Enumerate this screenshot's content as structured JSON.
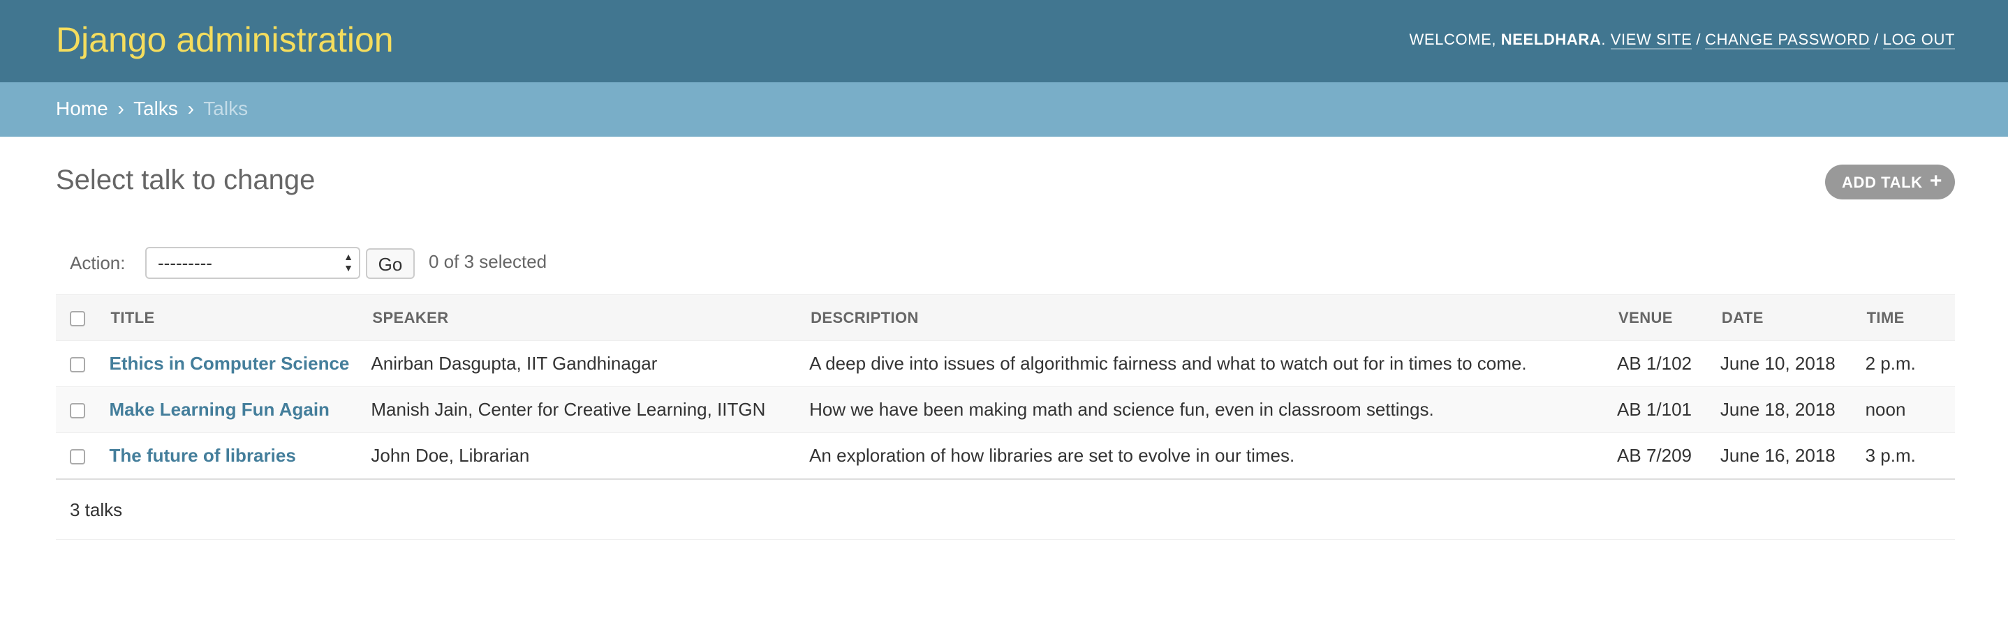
{
  "header": {
    "branding": "Django administration",
    "welcome": "Welcome,",
    "username": "Neeldhara",
    "view_site": "View site",
    "change_password": "Change password",
    "log_out": "Log out"
  },
  "breadcrumbs": {
    "home": "Home",
    "app": "Talks",
    "current": "Talks",
    "separator": "›"
  },
  "page": {
    "title": "Select talk to change",
    "add_button": "Add talk",
    "add_icon": "+"
  },
  "actions": {
    "label": "Action:",
    "selected_value": "---------",
    "go": "Go",
    "selected_count": "0 of 3 selected"
  },
  "table": {
    "columns": [
      "Title",
      "Speaker",
      "Description",
      "Venue",
      "Date",
      "Time"
    ],
    "rows": [
      {
        "title": "Ethics in Computer Science",
        "speaker": "Anirban Dasgupta, IIT Gandhinagar",
        "description": "A deep dive into issues of algorithmic fairness and what to watch out for in times to come.",
        "venue": "AB 1/102",
        "date": "June 10, 2018",
        "time": "2 p.m."
      },
      {
        "title": "Make Learning Fun Again",
        "speaker": "Manish Jain, Center for Creative Learning, IITGN",
        "description": "How we have been making math and science fun, even in classroom settings.",
        "venue": "AB 1/101",
        "date": "June 18, 2018",
        "time": "noon"
      },
      {
        "title": "The future of libraries",
        "speaker": "John Doe, Librarian",
        "description": "An exploration of how libraries are set to evolve in our times.",
        "venue": "AB 7/209",
        "date": "June 16, 2018",
        "time": "3 p.m."
      }
    ]
  },
  "paginator": {
    "count": "3 talks"
  },
  "colors": {
    "header_bg": "#417690",
    "branding": "#f5dd5d",
    "breadcrumbs_bg": "#79aec8",
    "link": "#447e9b",
    "add_button_bg": "#999999"
  }
}
